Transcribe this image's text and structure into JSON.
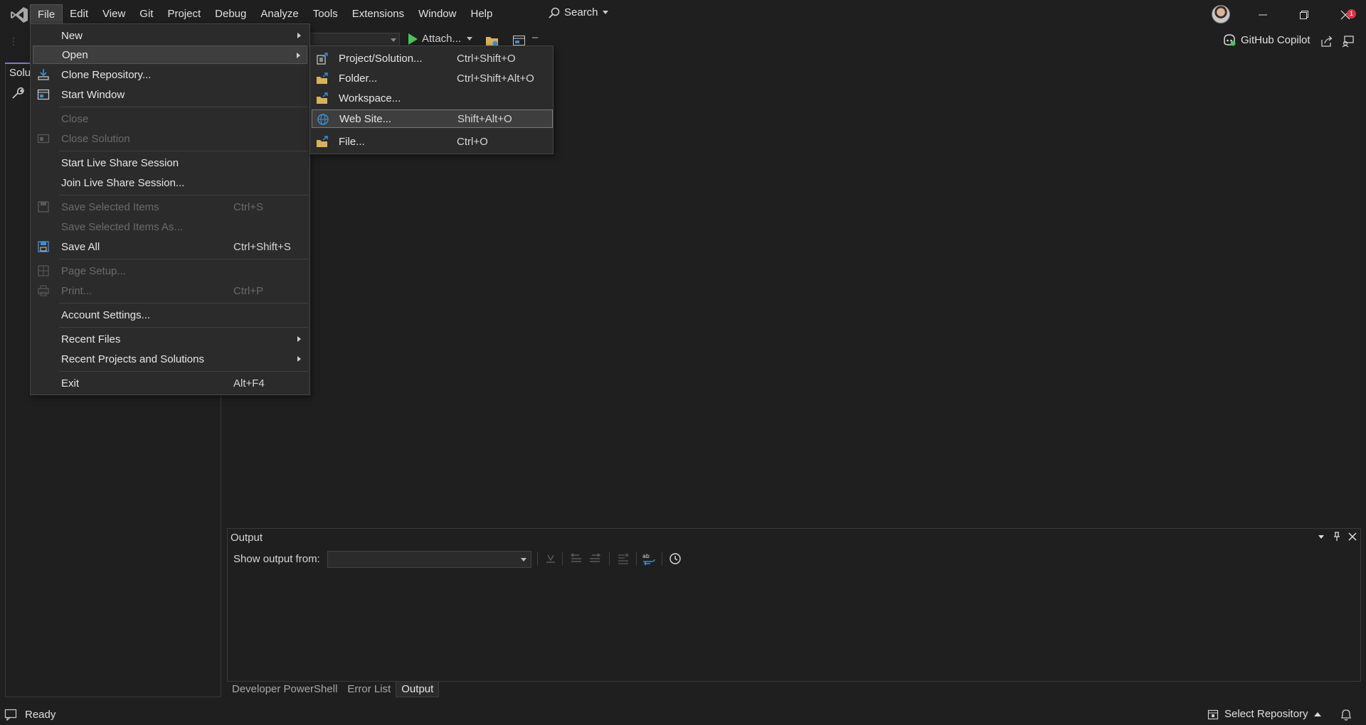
{
  "menubar": {
    "items": [
      "File",
      "Edit",
      "View",
      "Git",
      "Project",
      "Debug",
      "Analyze",
      "Tools",
      "Extensions",
      "Window",
      "Help"
    ],
    "search_label": "Search"
  },
  "toolbar": {
    "attach_label": "Attach...",
    "dash": "–",
    "copilot_label": "GitHub Copilot"
  },
  "solution_explorer": {
    "tab_label": "Solu"
  },
  "file_menu": {
    "new": "New",
    "open": "Open",
    "clone_repository": "Clone Repository...",
    "start_window": "Start Window",
    "close": "Close",
    "close_solution": "Close Solution",
    "start_live_share": "Start Live Share Session",
    "join_live_share": "Join Live Share Session...",
    "save_selected": "Save Selected Items",
    "save_selected_shortcut": "Ctrl+S",
    "save_selected_as": "Save Selected Items As...",
    "save_all": "Save All",
    "save_all_shortcut": "Ctrl+Shift+S",
    "page_setup": "Page Setup...",
    "print": "Print...",
    "print_shortcut": "Ctrl+P",
    "account_settings": "Account Settings...",
    "recent_files": "Recent Files",
    "recent_projects": "Recent Projects and Solutions",
    "exit": "Exit",
    "exit_shortcut": "Alt+F4"
  },
  "open_submenu": {
    "items": [
      {
        "label": "Project/Solution...",
        "shortcut": "Ctrl+Shift+O"
      },
      {
        "label": "Folder...",
        "shortcut": "Ctrl+Shift+Alt+O"
      },
      {
        "label": "Workspace...",
        "shortcut": ""
      },
      {
        "label": "Web Site...",
        "shortcut": "Shift+Alt+O"
      },
      {
        "label": "File...",
        "shortcut": "Ctrl+O"
      }
    ]
  },
  "output": {
    "title": "Output",
    "show_output_from": "Show output from:",
    "source_value": ""
  },
  "bottom_tabs": [
    "Developer PowerShell",
    "Error List",
    "Output"
  ],
  "status": {
    "text": "Ready",
    "select_repository": "Select Repository",
    "notification_count": "1"
  },
  "colors": {
    "background": "#1f1f1f",
    "menu_bg": "#2b2b2b",
    "accent_purple": "#8f6de0",
    "play_green": "#4cc35a",
    "badge_red": "#d9364a"
  }
}
